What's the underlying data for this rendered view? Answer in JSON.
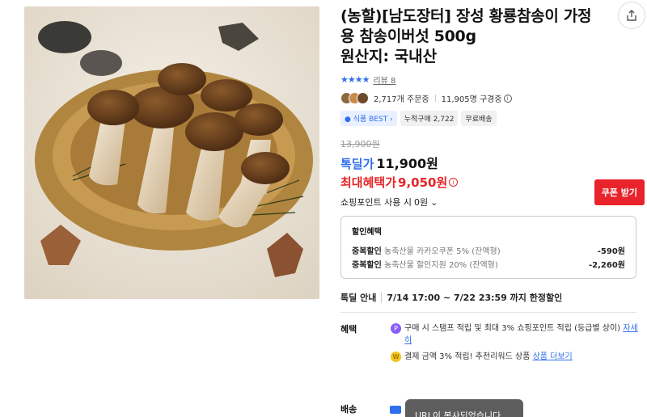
{
  "product": {
    "title": "(농할)[남도장터] 장성 황룡참송이 가정용 참송이버섯 500g",
    "origin": "원산지: 국내산",
    "rating_stars": "★★★★",
    "review_label": "리뷰 8",
    "orders": "2,717개 주문중",
    "subscribers": "11,905명 구경중",
    "badges": [
      "식품 BEST",
      "누적구매 2,722",
      "무료배송"
    ]
  },
  "price": {
    "original": "13,900원",
    "deal_label": "톡딜가",
    "deal_price": "11,900원",
    "best_label": "최대혜택가",
    "best_price": "9,050원",
    "coupon_button": "쿠폰 받기",
    "points_label": "쇼핑포인트 사용 시",
    "points_value": "0원"
  },
  "discount": {
    "heading": "할인혜택",
    "rows": [
      {
        "kind": "중복할인",
        "desc": "농축산물 카카오쿠폰 5% (잔액형)",
        "amount": "-590원"
      },
      {
        "kind": "중복할인",
        "desc": "농축산물 할인지원 20% (잔액형)",
        "amount": "-2,260원"
      }
    ]
  },
  "special": {
    "label": "톡딜 안내",
    "period": "7/14 17:00 ~ 7/22 23:59 까지 한정할인"
  },
  "benefit": {
    "label": "혜택",
    "item1_text": "구매 시 스탬프 적립 및 최대 3% 쇼핑포인트 적립 (등급별 상이)",
    "item1_link": "자세히",
    "item2_text": "결제 금액 3% 적립! 추천리워드 상품",
    "item2_link": "상품 더보기"
  },
  "delivery": {
    "label": "배송"
  },
  "toast": {
    "text": "URL이 복사되었습니다"
  },
  "colors": {
    "accent_blue": "#2f6fed",
    "accent_red": "#e8232b"
  }
}
